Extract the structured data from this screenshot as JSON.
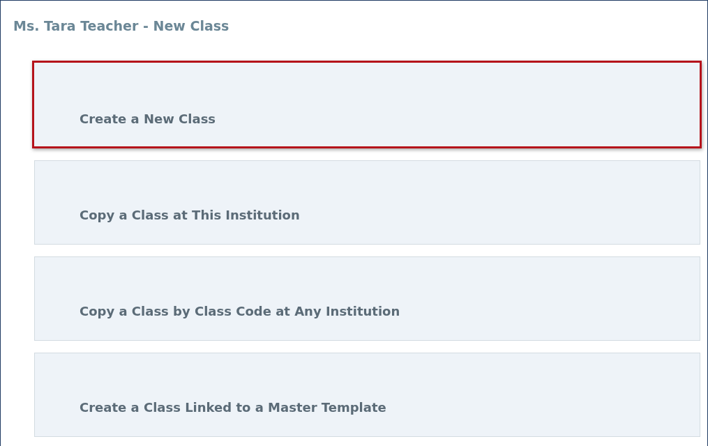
{
  "window": {
    "title": "Ms. Tara Teacher - New Class"
  },
  "options": [
    {
      "label": "Create a New Class",
      "selected": true
    },
    {
      "label": "Copy a Class at This Institution",
      "selected": false
    },
    {
      "label": "Copy a Class by Class Code at Any Institution",
      "selected": false
    },
    {
      "label": "Create a Class Linked to a Master Template",
      "selected": false
    }
  ]
}
